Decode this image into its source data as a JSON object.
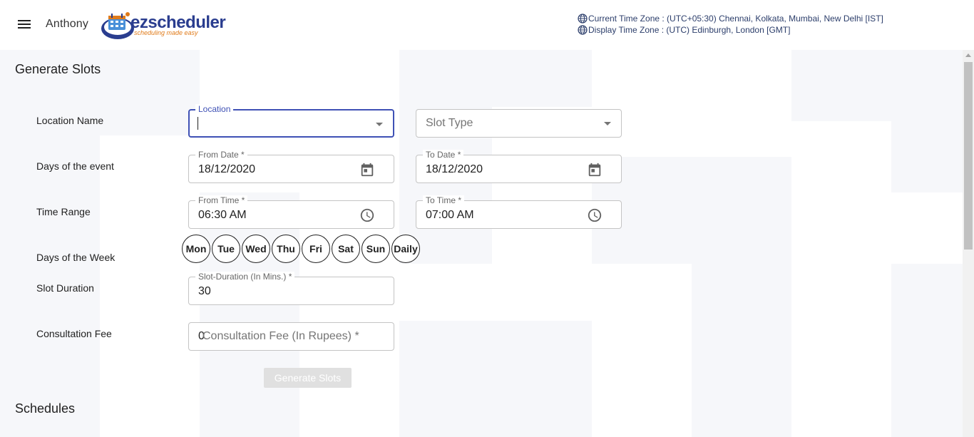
{
  "header": {
    "user_name": "Anthony",
    "logo_text": "ezscheduler",
    "logo_tagline": "scheduling made easy",
    "current_tz": "Current Time Zone : (UTC+05:30) Chennai, Kolkata, Mumbai, New Delhi [IST]",
    "display_tz": "Display Time Zone : (UTC) Edinburgh, London [GMT]",
    "icons": [
      "menu-icon",
      "globe-icon"
    ]
  },
  "generate": {
    "title": "Generate Slots",
    "labels": {
      "location": "Location Name",
      "days_event": "Days of the event",
      "time_range": "Time Range",
      "days_week": "Days of the Week",
      "slot_duration": "Slot Duration",
      "fee": "Consultation Fee"
    },
    "location": {
      "legend": "Location",
      "value": ""
    },
    "slot_type": {
      "placeholder": "Slot Type"
    },
    "from_date": {
      "legend": "From Date *",
      "value": "18/12/2020"
    },
    "to_date": {
      "legend": "To Date *",
      "value": "18/12/2020"
    },
    "from_time": {
      "legend": "From Time *",
      "value": "06:30 AM"
    },
    "to_time": {
      "legend": "To Time *",
      "value": "07:00 AM"
    },
    "days": [
      "Mon",
      "Tue",
      "Wed",
      "Thu",
      "Fri",
      "Sat",
      "Sun",
      "Daily"
    ],
    "slot_duration": {
      "legend": "Slot-Duration (In Mins.) *",
      "value": "30"
    },
    "fee": {
      "value": "0",
      "placeholder": "Consultation Fee (In Rupees) *"
    },
    "button": "Generate Slots"
  },
  "schedules": {
    "title": "Schedules"
  },
  "colors": {
    "accent": "#3f51b5",
    "logo_blue": "#2a3d8f",
    "logo_orange": "#e07b1a",
    "disabled_button": "#e0e0e0"
  }
}
